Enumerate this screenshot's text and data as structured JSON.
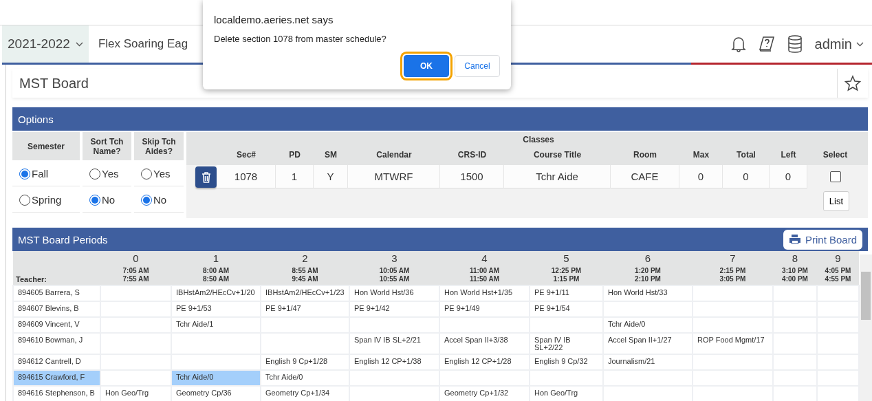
{
  "header": {
    "year": "2021-2022",
    "school": "Flex Soaring Eag",
    "user": "admin"
  },
  "dialog": {
    "title": "localdemo.aeries.net says",
    "message": "Delete section 1078 from master schedule?",
    "buttons": [
      {
        "label": "OK",
        "kind": "primary",
        "focused": true
      },
      {
        "label": "Cancel",
        "kind": "secondary",
        "focused": false
      }
    ]
  },
  "page": {
    "title": "MST Board",
    "favorite": false
  },
  "options": {
    "title": "Options",
    "groups": [
      {
        "heading": "Semester",
        "choices": [
          {
            "label": "Fall",
            "selected": true
          },
          {
            "label": "Spring",
            "selected": false
          }
        ]
      },
      {
        "heading": "Sort Tch Name?",
        "choices": [
          {
            "label": "Yes",
            "selected": false
          },
          {
            "label": "No",
            "selected": true
          }
        ]
      },
      {
        "heading": "Skip Tch Aides?",
        "choices": [
          {
            "label": "Yes",
            "selected": false
          },
          {
            "label": "No",
            "selected": true
          }
        ]
      }
    ],
    "classes": {
      "title": "Classes",
      "columns": [
        "Sec#",
        "PD",
        "SM",
        "Calendar",
        "CRS-ID",
        "Course Title",
        "Room",
        "Max",
        "Total",
        "Left",
        "Select"
      ],
      "row": {
        "cells": [
          "1078",
          "1",
          "Y",
          "MTWRF",
          "1500",
          "Tchr Aide",
          "CAFE",
          "0",
          "0",
          "0"
        ],
        "checked": false
      },
      "list_button": "List"
    }
  },
  "periods": {
    "title": "MST Board Periods",
    "print_button": "Print Board",
    "teacher_label": "Teacher:",
    "columns": [
      {
        "period": "0",
        "start": "7:05 AM",
        "end": "7:55 AM"
      },
      {
        "period": "1",
        "start": "8:00 AM",
        "end": "8:50 AM"
      },
      {
        "period": "2",
        "start": "8:55 AM",
        "end": "9:45 AM"
      },
      {
        "period": "3",
        "start": "10:05 AM",
        "end": "10:55 AM"
      },
      {
        "period": "4",
        "start": "11:00 AM",
        "end": "11:50 AM"
      },
      {
        "period": "5",
        "start": "12:25 PM",
        "end": "1:15 PM"
      },
      {
        "period": "6",
        "start": "1:20 PM",
        "end": "2:10 PM"
      },
      {
        "period": "7",
        "start": "2:15 PM",
        "end": "3:05 PM"
      },
      {
        "period": "8",
        "start": "3:10 PM",
        "end": "4:00 PM"
      },
      {
        "period": "9",
        "start": "4:05 PM",
        "end": "4:55 PM"
      }
    ],
    "rows": [
      {
        "teacher": "894605 Barrera, S",
        "selected": false,
        "cells": [
          {
            "selected": false
          },
          {
            "text": "IBHstAm2/HEcCv+1/20",
            "selected": false
          },
          {
            "text": "IBHstAm2/HEcCv+1/23",
            "selected": false
          },
          {
            "text": "Hon World Hst/36",
            "selected": false
          },
          {
            "text": "Hon World Hst+1/35",
            "selected": false
          },
          {
            "text": "PE 9+1/11",
            "selected": false
          },
          {
            "text": "Hon World Hst/33",
            "selected": false
          },
          {
            "selected": false
          },
          {
            "selected": false
          },
          {
            "selected": false
          }
        ]
      },
      {
        "teacher": "894607 Blevins, B",
        "selected": false,
        "cells": [
          {
            "selected": false
          },
          {
            "text": "PE 9+1/53",
            "selected": false
          },
          {
            "text": "PE 9+1/47",
            "selected": false
          },
          {
            "text": "PE 9+1/42",
            "selected": false
          },
          {
            "text": "PE 9+1/49",
            "selected": false
          },
          {
            "text": "PE 9+1/54",
            "selected": false
          },
          {
            "selected": false
          },
          {
            "selected": false
          },
          {
            "selected": false
          },
          {
            "selected": false
          }
        ]
      },
      {
        "teacher": "894609 Vincent, V",
        "selected": false,
        "cells": [
          {
            "selected": false
          },
          {
            "text": "Tchr Aide/1",
            "selected": false
          },
          {
            "selected": false
          },
          {
            "selected": false
          },
          {
            "selected": false
          },
          {
            "selected": false
          },
          {
            "text": "Tchr Aide/0",
            "selected": false
          },
          {
            "selected": false
          },
          {
            "selected": false
          },
          {
            "selected": false
          }
        ]
      },
      {
        "teacher": "894610 Bowman, J",
        "selected": false,
        "cells": [
          {
            "selected": false
          },
          {
            "selected": false
          },
          {
            "selected": false
          },
          {
            "text": "Span IV IB SL+2/21",
            "selected": false
          },
          {
            "text": "Accel Span II+3/38",
            "selected": false
          },
          {
            "text": "Span IV IB SL+2/22",
            "selected": false
          },
          {
            "text": "Accel Span II+1/27",
            "selected": false
          },
          {
            "text": "ROP Food Mgmt/17",
            "selected": false
          },
          {
            "selected": false
          },
          {
            "selected": false
          }
        ]
      },
      {
        "teacher": "894612 Cantrell, D",
        "selected": false,
        "cells": [
          {
            "selected": false
          },
          {
            "selected": false
          },
          {
            "text": "English 9 Cp+1/28",
            "selected": false
          },
          {
            "text": "English 12 CP+1/38",
            "selected": false
          },
          {
            "text": "English 12 CP+1/28",
            "selected": false
          },
          {
            "text": "English 9 Cp/32",
            "selected": false
          },
          {
            "text": "Journalism/21",
            "selected": false
          },
          {
            "selected": false
          },
          {
            "selected": false
          },
          {
            "selected": false
          }
        ]
      },
      {
        "teacher": "894615 Crawford, F",
        "selected": true,
        "cells": [
          {
            "selected": false
          },
          {
            "text": "Tchr Aide/0",
            "selected": true
          },
          {
            "text": "Tchr Aide/0",
            "selected": false
          },
          {
            "selected": false
          },
          {
            "selected": false
          },
          {
            "selected": false
          },
          {
            "selected": false
          },
          {
            "selected": false
          },
          {
            "selected": false
          },
          {
            "selected": false
          }
        ]
      },
      {
        "teacher": "894616 Stephenson, B",
        "selected": false,
        "cells": [
          {
            "text": "Hon Geo/Trg",
            "selected": false
          },
          {
            "text": "Geometry Cp/36",
            "selected": false
          },
          {
            "text": "Geometry Cp+1/34",
            "selected": false
          },
          {
            "selected": false
          },
          {
            "text": "Geometry Cp+1/32",
            "selected": false
          },
          {
            "text": "Hon Geo/Trg",
            "selected": false
          },
          {
            "selected": false
          },
          {
            "selected": false
          },
          {
            "selected": false
          },
          {
            "selected": false
          }
        ]
      }
    ]
  }
}
